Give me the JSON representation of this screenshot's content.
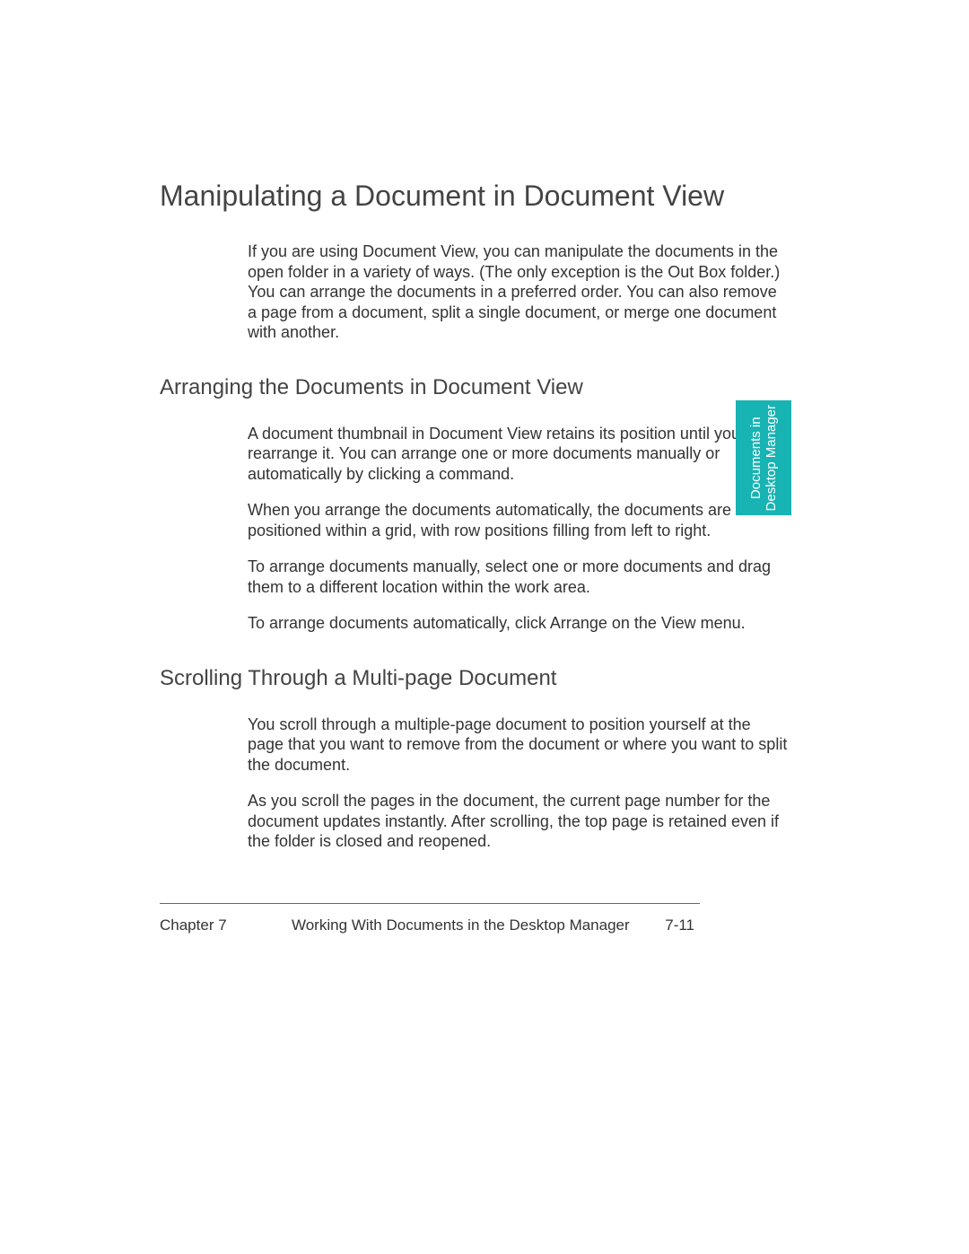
{
  "title": "Manipulating a Document in Document View",
  "intro": "If you are using Document View, you can manipulate the documents in the open folder in a variety of ways. (The only exception is the Out Box folder.) You can arrange the documents in a preferred order. You can also remove a page from a document, split a single document, or merge one document with another.",
  "section1": {
    "heading": "Arranging the Documents in Document View",
    "p1": "A document thumbnail in Document View retains its position until you rearrange it. You can arrange one or more documents manually or automatically by clicking a command.",
    "p2": "When you arrange the documents automatically, the documents are positioned within a grid, with row positions filling from left to right.",
    "p3": "To arrange documents manually, select one or more documents and drag them to a different location within the work area.",
    "p4": "To arrange documents automatically, click Arrange on the View menu."
  },
  "section2": {
    "heading": "Scrolling Through a Multi-page Document",
    "p1": "You scroll through a multiple-page document to position yourself at the page that you want to remove from the document or where you want to split the document.",
    "p2": "As you scroll the pages in the document, the current page number for the document updates instantly. After scrolling, the top page is retained even if the folder is closed and reopened."
  },
  "tab": {
    "line1": "Documents in",
    "line2": "Desktop Manager"
  },
  "footer": {
    "left": "Chapter 7",
    "center": "Working With Documents in the Desktop Manager",
    "page": "7-11"
  }
}
